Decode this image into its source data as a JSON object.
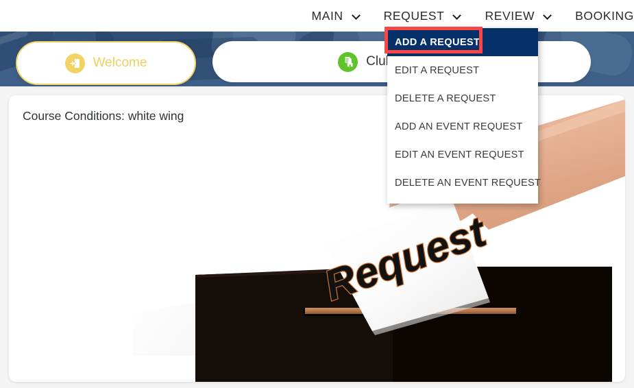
{
  "nav": {
    "items": [
      {
        "label": "MAIN",
        "has_chevron": true,
        "icon": "chevron-down-icon"
      },
      {
        "label": "REQUEST",
        "has_chevron": true,
        "icon": "chevron-down-icon"
      },
      {
        "label": "REVIEW",
        "has_chevron": true,
        "icon": "chevron-down-icon"
      },
      {
        "label": "BOOKING",
        "has_chevron": false,
        "icon": ""
      }
    ]
  },
  "tabs": [
    {
      "label": "Welcome",
      "icon": "door-enter-icon",
      "active": true,
      "accent": "#f2d264"
    },
    {
      "label": "Club Home Page",
      "icon": "document-home-icon",
      "active": false,
      "accent": "#5fc32a"
    }
  ],
  "content": {
    "course_conditions": "Course Conditions: white wing",
    "illustration": {
      "name": "ballot-box-request-illustration",
      "ballot_text": "Request"
    }
  },
  "dropdown": {
    "parent": "REQUEST",
    "items": [
      {
        "label": "ADD A REQUEST",
        "active": true
      },
      {
        "label": "EDIT A REQUEST",
        "active": false
      },
      {
        "label": "DELETE A REQUEST",
        "active": false
      },
      {
        "label": "ADD AN EVENT REQUEST",
        "active": false
      },
      {
        "label": "EDIT AN EVENT REQUEST",
        "active": false
      },
      {
        "label": "DELETE AN EVENT REQUEST",
        "active": false
      }
    ]
  },
  "annotation": {
    "name": "highlight-rectangle",
    "target": "ADD A REQUEST",
    "color": "#fc4646"
  },
  "colors": {
    "banner_blue": "#3e5f87",
    "active_menu_navy": "#053069",
    "highlight_red": "#fc4646",
    "welcome_yellow": "#f2d264",
    "club_green": "#5fc32a",
    "page_background": "#f4f4f4"
  }
}
